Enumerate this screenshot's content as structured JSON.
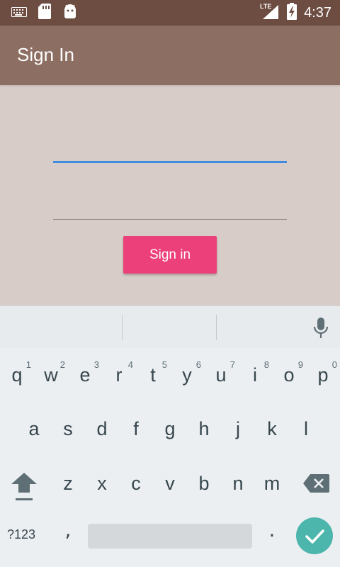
{
  "status_bar": {
    "time": "4:37",
    "network": "LTE",
    "icons": [
      "keyboard-icon",
      "sd-card-icon",
      "android-icon",
      "signal-icon",
      "battery-charging-icon"
    ]
  },
  "app_bar": {
    "title": "Sign In"
  },
  "form": {
    "email_placeholder": "",
    "password_placeholder": "",
    "sign_in_label": "Sign in"
  },
  "keyboard": {
    "row1": [
      {
        "char": "q",
        "hint": "1"
      },
      {
        "char": "w",
        "hint": "2"
      },
      {
        "char": "e",
        "hint": "3"
      },
      {
        "char": "r",
        "hint": "4"
      },
      {
        "char": "t",
        "hint": "5"
      },
      {
        "char": "y",
        "hint": "6"
      },
      {
        "char": "u",
        "hint": "7"
      },
      {
        "char": "i",
        "hint": "8"
      },
      {
        "char": "o",
        "hint": "9"
      },
      {
        "char": "p",
        "hint": "0"
      }
    ],
    "row2": [
      "a",
      "s",
      "d",
      "f",
      "g",
      "h",
      "j",
      "k",
      "l"
    ],
    "row3": [
      "z",
      "x",
      "c",
      "v",
      "b",
      "n",
      "m"
    ],
    "symbols_label": "?123",
    "comma": ",",
    "period": "."
  },
  "colors": {
    "status_bar": "#6d4c41",
    "app_bar": "#8d6e63",
    "background": "#d7ccc8",
    "accent_blue": "#3f8de0",
    "button": "#ec407a",
    "enter": "#4db6ac"
  }
}
